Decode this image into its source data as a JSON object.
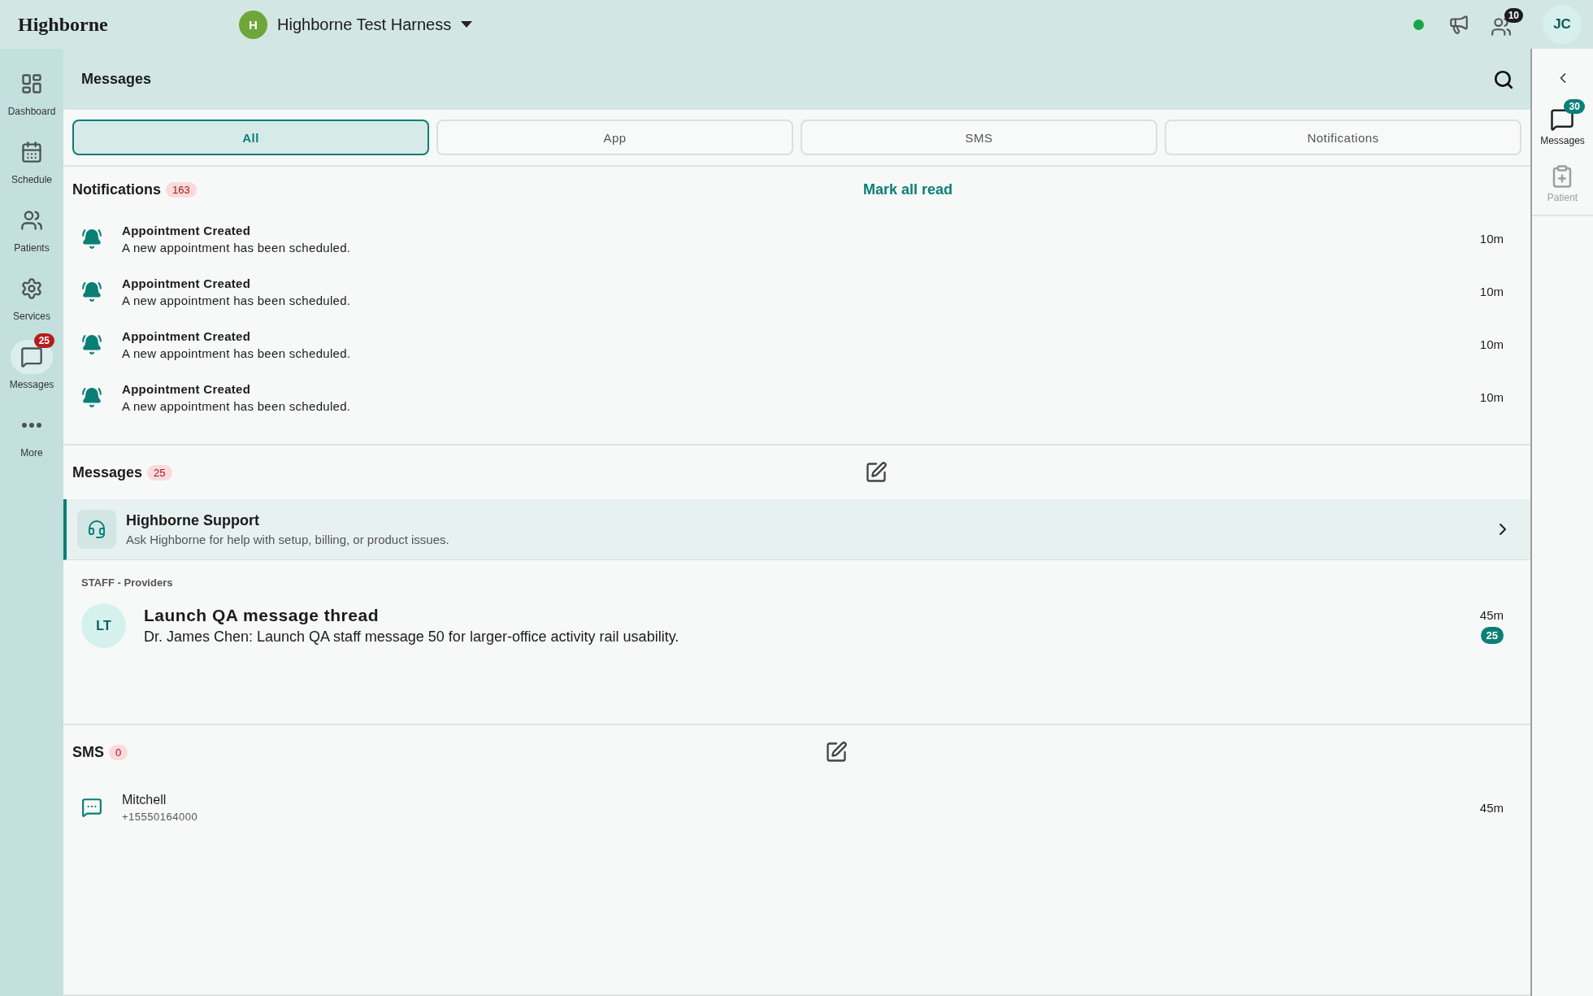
{
  "topbar": {
    "logo": "Highborne",
    "org": {
      "initial": "H",
      "name": "Highborne Test Harness"
    },
    "online": true,
    "staff_badge": "10",
    "user_initials": "JC"
  },
  "sidebar": {
    "items": [
      {
        "kind": "dashboard",
        "label": "Dashboard",
        "selected": false
      },
      {
        "kind": "schedule",
        "label": "Schedule",
        "selected": false
      },
      {
        "kind": "patients",
        "label": "Patients",
        "selected": false
      },
      {
        "kind": "services",
        "label": "Services",
        "selected": false
      },
      {
        "kind": "messages",
        "label": "Messages",
        "badge": "25",
        "selected": true
      },
      {
        "kind": "more",
        "label": "More",
        "selected": false
      }
    ]
  },
  "page": {
    "title": "Messages"
  },
  "tabs": [
    {
      "label": "All",
      "selected": true
    },
    {
      "label": "App",
      "selected": false
    },
    {
      "label": "SMS",
      "selected": false
    },
    {
      "label": "Notifications",
      "selected": false
    }
  ],
  "notifications": {
    "title": "Notifications",
    "count": "163",
    "action": "Mark all read",
    "items": [
      {
        "title": "Appointment Created",
        "body": "A new appointment has been scheduled.",
        "time": "10m"
      },
      {
        "title": "Appointment Created",
        "body": "A new appointment has been scheduled.",
        "time": "10m"
      },
      {
        "title": "Appointment Created",
        "body": "A new appointment has been scheduled.",
        "time": "10m"
      },
      {
        "title": "Appointment Created",
        "body": "A new appointment has been scheduled.",
        "time": "10m"
      }
    ]
  },
  "messages": {
    "title": "Messages",
    "count": "25",
    "support": {
      "title": "Highborne Support",
      "body": "Ask Highborne for help with setup, billing, or product issues."
    },
    "group_label": "STAFF - Providers",
    "threads": [
      {
        "initials": "LT",
        "title": "Launch QA message thread",
        "preview": "Dr. James Chen: Launch QA staff message 50 for larger-office activity rail usability.",
        "time": "45m",
        "unread": "25"
      }
    ]
  },
  "sms": {
    "title": "SMS",
    "count": "0",
    "items": [
      {
        "name": "Mitchell",
        "phone": "+15550164000",
        "time": "45m"
      }
    ]
  },
  "right_rail": {
    "items": [
      {
        "kind": "messages",
        "label": "Messages",
        "badge": "30",
        "selected": true
      },
      {
        "kind": "patient",
        "label": "Patient",
        "selected": false
      }
    ]
  }
}
